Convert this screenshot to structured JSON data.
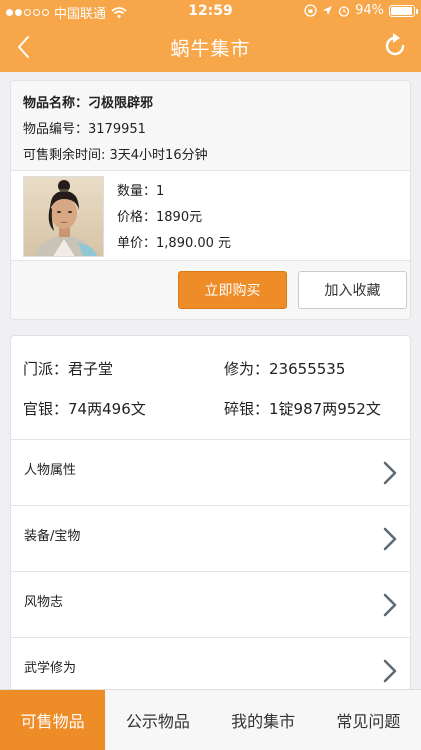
{
  "status": {
    "carrier": "中国联通",
    "time": "12:59",
    "battery": "94%",
    "battery_level": 0.94
  },
  "nav": {
    "title": "蜗牛集市",
    "back_icon": "chevron-left-icon",
    "refresh_icon": "refresh-icon"
  },
  "item": {
    "name_label": "物品名称：",
    "name": "刁极限辟邪",
    "id_label": "物品编号：",
    "id": "3179951",
    "time_label": "可售剩余时间: ",
    "time_left": "3天4小时16分钟",
    "qty_label": "数量：",
    "qty": "1",
    "price_label": "价格：",
    "price": "1890元",
    "unit_label": "单价：",
    "unit_price": "1,890.00 元"
  },
  "actions": {
    "buy": "立即购买",
    "favorite": "加入收藏"
  },
  "stats": {
    "sect_label": "门派：",
    "sect": "君子堂",
    "cultivation_label": "修为：",
    "cultivation": "23655535",
    "official_silver_label": "官银：",
    "official_silver": "74两496文",
    "broken_silver_label": "碎银：",
    "broken_silver": "1锭987两952文"
  },
  "menu": [
    {
      "label": "人物属性"
    },
    {
      "label": "装备/宝物"
    },
    {
      "label": "风物志"
    },
    {
      "label": "武学修为"
    }
  ],
  "tabs": [
    {
      "label": "可售物品",
      "active": true
    },
    {
      "label": "公示物品"
    },
    {
      "label": "我的集市"
    },
    {
      "label": "常见问题"
    }
  ],
  "colors": {
    "accent": "#f7a64a",
    "button": "#ee8c28"
  }
}
